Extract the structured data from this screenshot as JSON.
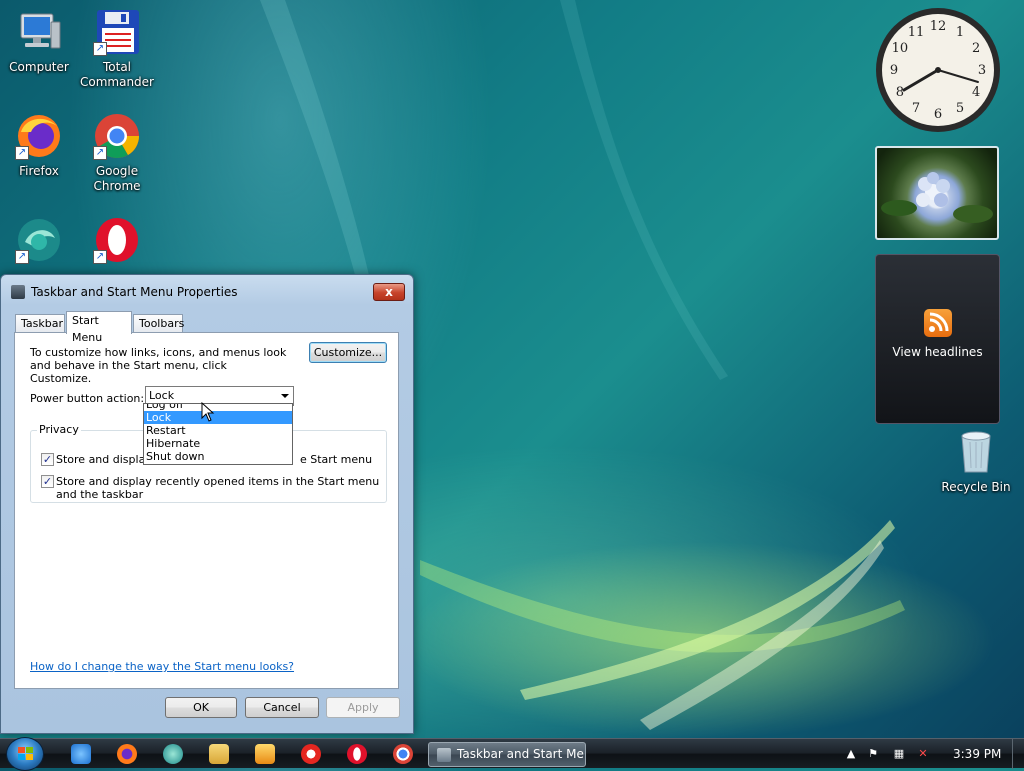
{
  "desktop": {
    "icons": [
      {
        "label": "Computer",
        "icon": "computer-icon"
      },
      {
        "label": "Total Commander",
        "icon": "floppy-icon"
      },
      {
        "label": "Firefox",
        "icon": "firefox-icon"
      },
      {
        "label": "Google Chrome",
        "icon": "chrome-icon"
      },
      {
        "label": "",
        "icon": "app-icon"
      },
      {
        "label": "",
        "icon": "opera-icon"
      },
      {
        "label": "Recycle Bin",
        "icon": "recycle-bin-icon"
      }
    ]
  },
  "gadgets": {
    "clock": {
      "numbers": [
        "12",
        "1",
        "2",
        "3",
        "4",
        "5",
        "6",
        "7",
        "8",
        "9",
        "10",
        "11"
      ]
    },
    "feed": {
      "label": "View headlines",
      "icon": "rss-icon"
    }
  },
  "dialog": {
    "title": "Taskbar and Start Menu Properties",
    "close_label": "x",
    "tabs": [
      "Taskbar",
      "Start Menu",
      "Toolbars"
    ],
    "active_tab": "Start Menu",
    "description": "To customize how links, icons, and menus look and behave in the Start menu, click Customize.",
    "customize_button": "Customize...",
    "power_button_label": "Power button action:",
    "power_button_value": "Lock",
    "power_options": [
      "Log off",
      "Lock",
      "Restart",
      "Hibernate",
      "Shut down"
    ],
    "power_selected_index": 1,
    "privacy": {
      "legend": "Privacy",
      "option1_start": "Store and display r",
      "option1_end": "e Start menu",
      "option1_checked": true,
      "option2": "Store and display recently opened items in the Start menu and the taskbar",
      "option2_checked": true
    },
    "help_link": "How do I change the way the Start menu looks?",
    "ok": "OK",
    "cancel": "Cancel",
    "apply": "Apply"
  },
  "taskbar": {
    "task_label": "Taskbar and Start Me...",
    "clock": "3:39 PM",
    "quick_launch": [
      "ie-icon",
      "firefox-icon",
      "app-icon",
      "explorer-folder-icon",
      "media-player-icon",
      "yandex-icon",
      "opera-icon",
      "chrome-icon"
    ]
  }
}
